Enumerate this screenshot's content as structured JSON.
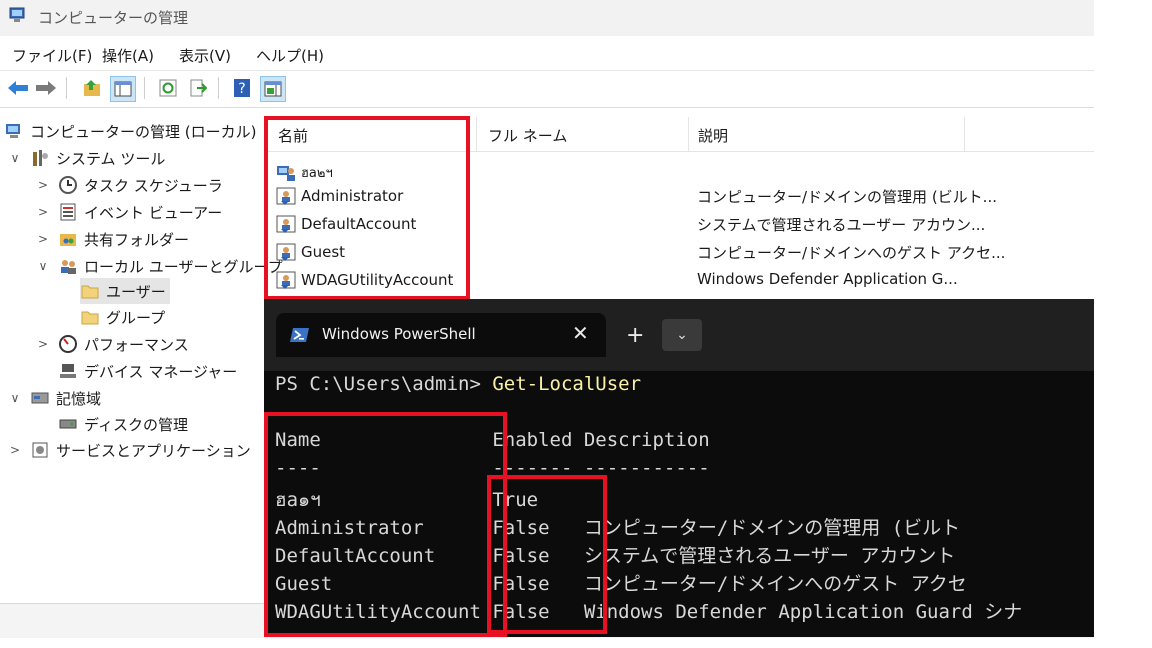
{
  "window": {
    "title": "コンピューターの管理"
  },
  "menu": [
    "ファイル(F)",
    "操作(A)",
    "表示(V)",
    "ヘルプ(H)"
  ],
  "tree": [
    {
      "label": "コンピューターの管理 (ローカル)",
      "chev": ""
    },
    {
      "label": "システム ツール",
      "chev": "∨"
    },
    {
      "label": "タスク スケジューラ",
      "chev": ">"
    },
    {
      "label": "イベント ビューアー",
      "chev": ">"
    },
    {
      "label": "共有フォルダー",
      "chev": ">"
    },
    {
      "label": "ローカル ユーザーとグループ",
      "chev": "∨"
    },
    {
      "label": "ユーザー",
      "chev": ""
    },
    {
      "label": "グループ",
      "chev": ""
    },
    {
      "label": "パフォーマンス",
      "chev": ">"
    },
    {
      "label": "デバイス マネージャー",
      "chev": ""
    },
    {
      "label": "記憶域",
      "chev": "∨"
    },
    {
      "label": "ディスクの管理",
      "chev": ""
    },
    {
      "label": "サービスとアプリケーション",
      "chev": ">"
    }
  ],
  "list": {
    "columns": [
      "名前",
      "フル ネーム",
      "説明"
    ],
    "rows": [
      {
        "name": "ฮa๒ฯ",
        "full": "",
        "desc": ""
      },
      {
        "name": "Administrator",
        "full": "",
        "desc": "コンピューター/ドメインの管理用 (ビルト..."
      },
      {
        "name": "DefaultAccount",
        "full": "",
        "desc": "システムで管理されるユーザー アカウン..."
      },
      {
        "name": "Guest",
        "full": "",
        "desc": "コンピューター/ドメインへのゲスト アクセ..."
      },
      {
        "name": "WDAGUtilityAccount",
        "full": "",
        "desc": "Windows Defender Application G..."
      }
    ]
  },
  "terminal": {
    "tab_title": "Windows PowerShell",
    "tab_close": "✕",
    "new_tab": "+",
    "dropdown": "⌄",
    "prompt": "PS C:\\Users\\admin> ",
    "command": "Get-LocalUser",
    "header": "Name               Enabled Description",
    "underline": "----               ------- -----------",
    "rows": [
      "ฮa๑ฯ               True",
      "Administrator      False   コンピューター/ドメインの管理用 (ビルト",
      "DefaultAccount     False   システムで管理されるユーザー アカウント",
      "Guest              False   コンピューター/ドメインへのゲスト アクセ",
      "WDAGUtilityAccount False   Windows Defender Application Guard シナ"
    ]
  },
  "colors": {
    "highlight": "#e81123",
    "terminal_bg": "#0c0c0c",
    "command": "#f9f1a5"
  }
}
